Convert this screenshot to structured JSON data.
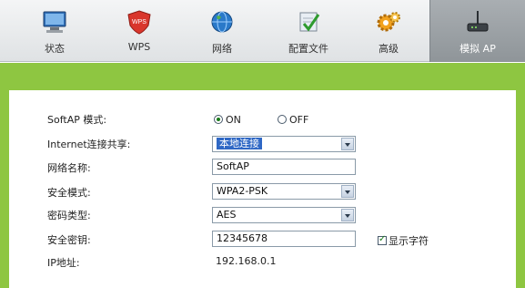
{
  "tabs": [
    {
      "label": "状态",
      "icon": "monitor-icon",
      "active": false
    },
    {
      "label": "WPS",
      "icon": "wps-shield-icon",
      "active": false
    },
    {
      "label": "网络",
      "icon": "globe-icon",
      "active": false
    },
    {
      "label": "配置文件",
      "icon": "profile-check-icon",
      "active": false
    },
    {
      "label": "高级",
      "icon": "gears-icon",
      "active": false
    },
    {
      "label": "模拟 AP",
      "icon": "router-antenna-icon",
      "active": true
    }
  ],
  "form": {
    "softap_mode": {
      "label": "SoftAP 模式:",
      "options": [
        "ON",
        "OFF"
      ],
      "selected": "ON"
    },
    "internet_sharing": {
      "label": "Internet连接共享:",
      "value": "本地连接"
    },
    "network_name": {
      "label": "网络名称:",
      "value": "SoftAP"
    },
    "security_mode": {
      "label": "安全模式:",
      "value": "WPA2-PSK"
    },
    "cipher_type": {
      "label": "密码类型:",
      "value": "AES"
    },
    "security_key": {
      "label": "安全密钥:",
      "value": "12345678"
    },
    "show_chars": {
      "label": "显示字符",
      "checked": true
    },
    "ip_address": {
      "label": "IP地址:",
      "value": "192.168.0.1"
    }
  },
  "colors": {
    "frame_green": "#8ec641",
    "active_tab": "#989ea2",
    "select_highlight": "#2f68c5"
  }
}
